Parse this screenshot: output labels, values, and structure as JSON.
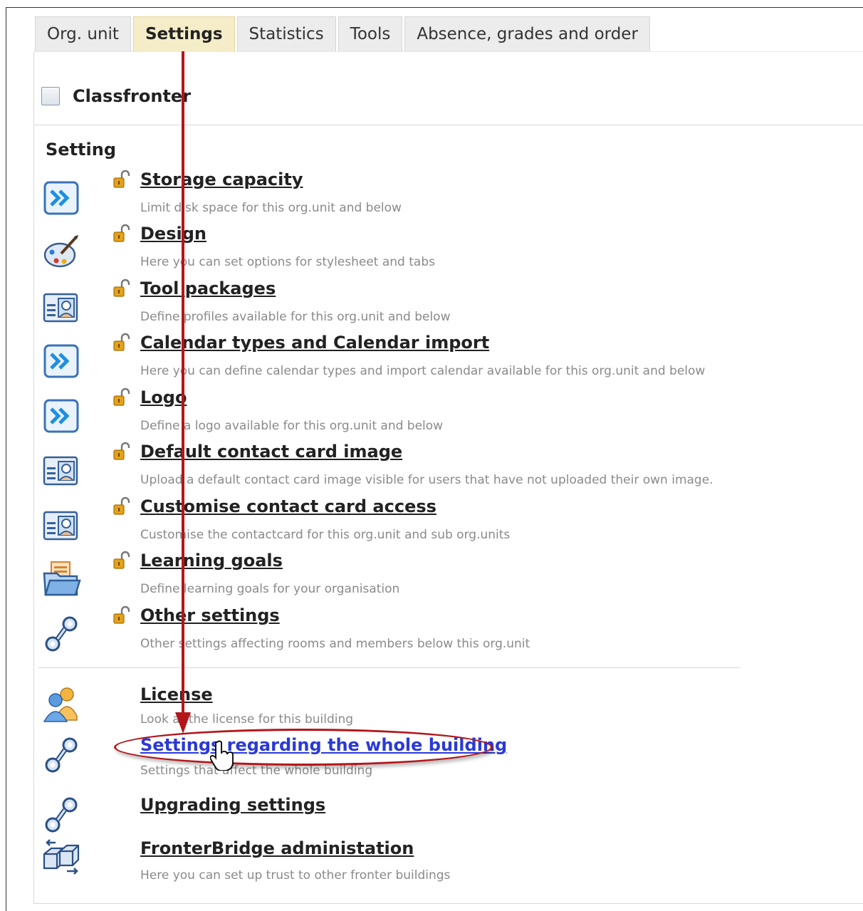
{
  "tabs": [
    {
      "label": "Org. unit",
      "active": false
    },
    {
      "label": "Settings",
      "active": true
    },
    {
      "label": "Statistics",
      "active": false
    },
    {
      "label": "Tools",
      "active": false
    },
    {
      "label": "Absence, grades and order",
      "active": false
    }
  ],
  "classfronter": {
    "label": "Classfronter",
    "checked": false
  },
  "section": {
    "title": "Setting"
  },
  "settings_items": [
    {
      "icon": "arrow-forward-icon",
      "title": "Storage capacity",
      "desc": "Limit disk space for this org.unit and below"
    },
    {
      "icon": "palette-icon",
      "title": "Design",
      "desc": "Here you can set options for stylesheet and tabs"
    },
    {
      "icon": "profile-card-icon",
      "title": "Tool packages",
      "desc": "Define profiles available for this org.unit and below"
    },
    {
      "icon": "arrow-forward-icon",
      "title": "Calendar types and Calendar import",
      "desc": "Here you can define calendar types and import calendar available for this org.unit and below"
    },
    {
      "icon": "arrow-forward-icon",
      "title": "Logo",
      "desc": "Define a logo available for this org.unit and below"
    },
    {
      "icon": "profile-card-icon",
      "title": "Default contact card image",
      "desc": "Upload a default contact card image visible for users that have not uploaded their own image."
    },
    {
      "icon": "profile-card-icon",
      "title": "Customise contact card access",
      "desc": "Customise the contactcard for this org.unit and sub org.units"
    },
    {
      "icon": "open-folder-icon",
      "title": "Learning goals",
      "desc": "Define learning goals for your organisation"
    },
    {
      "icon": "wrench-icon",
      "title": "Other settings",
      "desc": "Other settings affecting rooms and members below this org.unit"
    }
  ],
  "building_items": [
    {
      "icon": "users-icon",
      "title": "License",
      "desc": "Look at the license for this building"
    },
    {
      "icon": "wrench-icon",
      "title": "Settings regarding the whole building",
      "desc": "Settings that affect the whole building",
      "highlighted": true
    },
    {
      "icon": "wrench-icon",
      "title": "Upgrading settings",
      "desc": ""
    },
    {
      "icon": "bridge-cubes-icon",
      "title": "FronterBridge administation",
      "desc": "Here you can set up trust to other fronter buildings"
    }
  ],
  "colors": {
    "annotation": "#b3161a",
    "active_tab": "#f5edc8",
    "link_highlight": "#2a3ad6"
  }
}
